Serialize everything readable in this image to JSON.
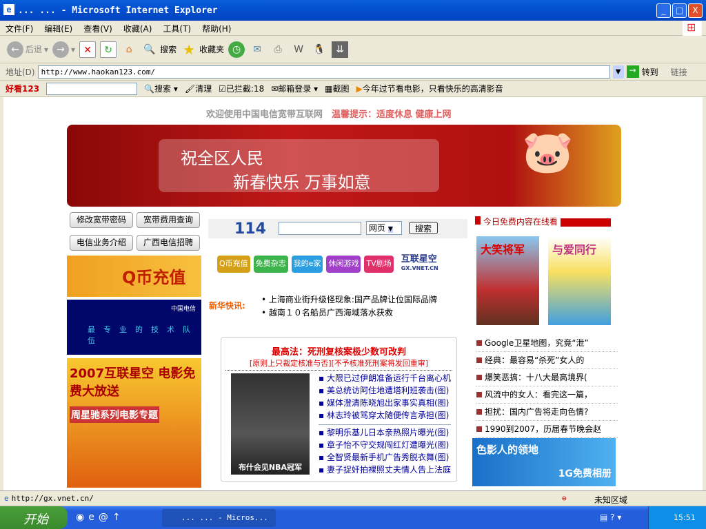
{
  "window": {
    "title": "... ... - Microsoft Internet Explorer",
    "min": "_",
    "max": "□",
    "close": "X"
  },
  "menu": [
    "文件(F)",
    "编辑(E)",
    "查看(V)",
    "收藏(A)",
    "工具(T)",
    "帮助(H)"
  ],
  "toolbar": {
    "back": "后退",
    "search": "搜索",
    "favorites": "收藏夹"
  },
  "address": {
    "label": "地址(D)",
    "url": "http://www.haokan123.com/",
    "go": "转到",
    "links": "链接"
  },
  "linkbar": {
    "brand": "好看123",
    "search": "搜索",
    "clean": "清理",
    "blocked": "已拦截:18",
    "mail": "邮箱登录",
    "screenshot": "截图",
    "promo": "今年过节看电影，只看快乐的高清影音"
  },
  "page": {
    "welcome": "欢迎使用中国电信宽带互联网",
    "tip": "温馨提示：适度休息  健康上网",
    "banner": {
      "line1": "祝全区人民",
      "line2": "新春快乐  万事如意"
    },
    "left_buttons": [
      "修改宽带密码",
      "宽带费用查询",
      "电信业务介绍",
      "广西电信招聘"
    ],
    "qcoin": "Q币充值",
    "telecom": "中国电信",
    "telecom_slogan": "最专业的技术队伍",
    "promo2007": "2007互联星空 电影免费大放送",
    "promo2007b": "周星驰系列电影专题",
    "search": {
      "logo": "114",
      "select": "网页",
      "button": "搜索"
    },
    "quick": [
      "Q币充值",
      "免费杂志",
      "我的e家",
      "休闲游戏",
      "TV剧场"
    ],
    "quick_colors": [
      "#d4a017",
      "#3cb44b",
      "#2a9ee0",
      "#a040c8",
      "#e0306a"
    ],
    "vnet": "互联星空",
    "vnet_url": "GX.VNET.CN",
    "xinhua_label": "新华快讯:",
    "xinhua": [
      "上海商业街升级怪现象:国产品牌让位国际品牌",
      "越南１０名船员广西海域落水获救"
    ],
    "headline": "最高法：死刑复核案极少数可改判",
    "subhead": "[原则上只裁定核准与否][不予核准死刑案将发回重审]",
    "photo_caption": "布什会见NBA冠军",
    "news1": [
      "大限已过伊朗准备运行千台离心机",
      "美总统访阿住地遭塔利班袭击(图)",
      "媒体澄清陈晓旭出家事实真相(图)",
      "林志玲被骂穿太随便传言承担(图)"
    ],
    "news2": [
      "黎明乐基儿日本亲热照片曝光(图)",
      "章子怡不守交规闯红灯遭曝光(图)",
      "全智贤最新手机广告秀脱衣舞(图)",
      "妻子捉奸拍裸照丈夫情人告上法庭"
    ],
    "right_header": "今日免费内容在线看",
    "posters": [
      "大笑将军",
      "与爱同行"
    ],
    "right_list": [
      "Google卫星地图，究竟“泄”",
      "经典：最容易“杀死”女人的",
      "爆笑恶搞：十八大最高境界(",
      "风流中的女人：看完这一篇，",
      "担扰：国内广告将走向色情?",
      "1990到2007，历届春节晚会赵"
    ],
    "right_banner": "色影人的领地",
    "right_banner2": "1G免费相册"
  },
  "status": {
    "url": "http://gx.vnet.cn/",
    "zone": "未知区域"
  },
  "taskbar": {
    "start": "开始",
    "task": "... ... - Micros...",
    "clock": "15:51"
  }
}
